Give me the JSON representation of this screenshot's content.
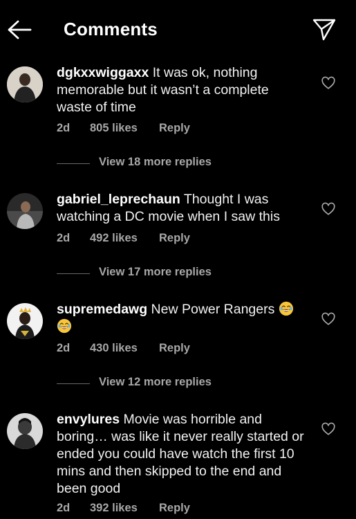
{
  "header": {
    "title": "Comments",
    "back_icon": "arrow-left-icon",
    "share_icon": "paper-plane-icon"
  },
  "comments": [
    {
      "username": "dgkxxwiggaxx",
      "text": "It was ok, nothing memorable but it wasn’t a complete waste of time",
      "time": "2d",
      "likes": "805 likes",
      "reply": "Reply",
      "replies_label": "View 18 more replies"
    },
    {
      "username": "gabriel_leprechaun",
      "text": "Thought I was watching a DC movie when I saw this",
      "time": "2d",
      "likes": "492 likes",
      "reply": "Reply",
      "replies_label": "View 17 more replies"
    },
    {
      "username": "supremedawg",
      "text": "New Power Rangers",
      "emoji": "😂😂",
      "time": "2d",
      "likes": "430 likes",
      "reply": "Reply",
      "replies_label": "View 12 more replies"
    },
    {
      "username": "envylures",
      "text": "Movie was horrible and boring… was like it never really started or ended you could have watch the first 10 mins and then skipped to the end and been good",
      "time": "2d",
      "likes": "392 likes",
      "reply": "Reply"
    }
  ],
  "icons": {
    "like": "heart-outline-icon"
  },
  "colors": {
    "background": "#000000",
    "text": "#ffffff",
    "secondary": "#a8a8a8"
  }
}
